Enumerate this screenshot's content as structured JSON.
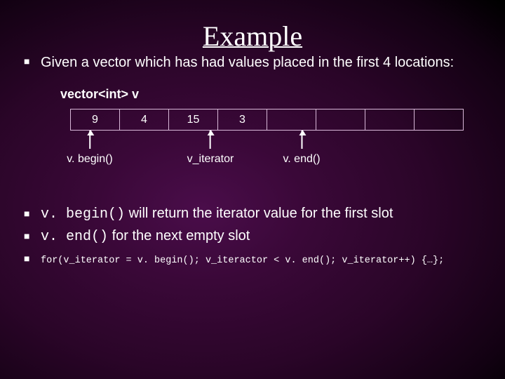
{
  "title": "Example",
  "bullet_intro": "Given a vector which has had values placed in the first 4 locations:",
  "declaration": "vector<int> v",
  "cells": [
    "9",
    "4",
    "15",
    "3",
    "",
    "",
    "",
    ""
  ],
  "labels": {
    "begin": "v. begin()",
    "iter": "v_iterator",
    "end": "v. end()"
  },
  "b1": {
    "code": "v. begin()",
    "rest": " will return the iterator value for the first slot"
  },
  "b2": {
    "code": "v. end()",
    "rest": " for the next empty slot"
  },
  "b3": "for(v_iterator = v. begin(); v_iteractor < v. end(); v_iterator++)  {…};"
}
